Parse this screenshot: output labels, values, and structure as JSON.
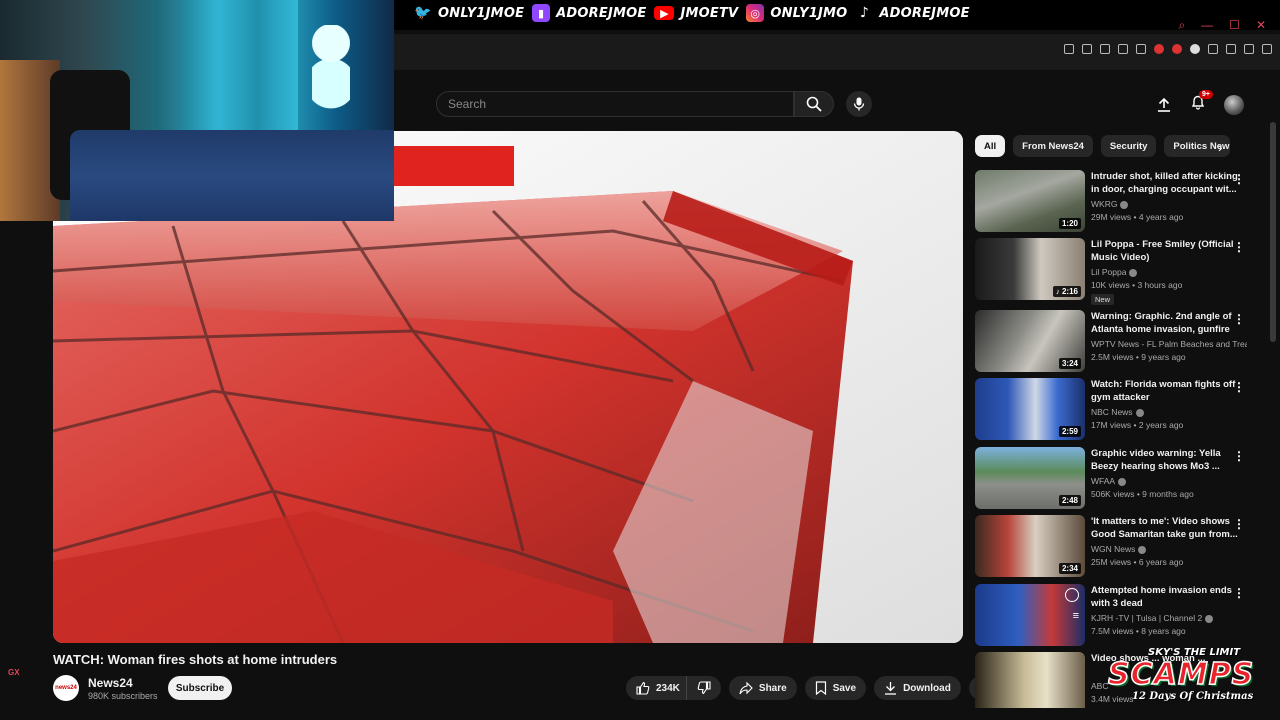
{
  "socials": [
    {
      "platform": "twitter-icon",
      "handle": "ONLY1JMOE",
      "color": "#1da1f2"
    },
    {
      "platform": "twitch-icon",
      "handle": "ADOREJMOE",
      "color": "#9146ff"
    },
    {
      "platform": "youtube-icon",
      "handle": "JMOETV",
      "color": "#ff0000"
    },
    {
      "platform": "instagram-icon",
      "handle": "ONLY1JMO",
      "color": "#e1306c"
    },
    {
      "platform": "tiktok-icon",
      "handle": "ADOREJMOE",
      "color": "#ffffff"
    }
  ],
  "header": {
    "search_placeholder": "Search",
    "notification_count": "9+"
  },
  "video": {
    "title": "WATCH: Woman fires shots at home intruders",
    "channel": "News24",
    "channel_avatar_text": "news24",
    "subscribers": "980K subscribers",
    "subscribe_label": "Subscribe",
    "likes": "234K",
    "share_label": "Share",
    "save_label": "Save",
    "download_label": "Download"
  },
  "chips": [
    "All",
    "From News24",
    "Security",
    "Politics News"
  ],
  "recommendations": [
    {
      "title": "Intruder shot, killed after kicking in door, charging occupant wit...",
      "channel": "WKRG",
      "verified": true,
      "views": "29M views",
      "age": "4 years ago",
      "duration": "1:20",
      "new": false
    },
    {
      "title": "Lil Poppa - Free Smiley (Official Music Video)",
      "channel": "Lil Poppa",
      "verified": true,
      "views": "10K views",
      "age": "3 hours ago",
      "duration": "2:16",
      "new": true,
      "new_label": "New"
    },
    {
      "title": "Warning: Graphic. 2nd angle of Atlanta home invasion, gunfire",
      "channel": "WPTV News - FL Palm Beaches and Trea...",
      "verified": false,
      "views": "2.5M views",
      "age": "9 years ago",
      "duration": "3:24",
      "new": false
    },
    {
      "title": "Watch: Florida woman fights off gym attacker",
      "channel": "NBC News",
      "verified": true,
      "views": "17M views",
      "age": "2 years ago",
      "duration": "2:59",
      "new": false
    },
    {
      "title": "Graphic video warning: Yella Beezy hearing shows Mo3 ...",
      "channel": "WFAA",
      "verified": true,
      "views": "506K views",
      "age": "9 months ago",
      "duration": "2:48",
      "new": false
    },
    {
      "title": "'It matters to me': Video shows Good Samaritan take gun from...",
      "channel": "WGN News",
      "verified": true,
      "views": "25M views",
      "age": "6 years ago",
      "duration": "2:34",
      "new": false
    },
    {
      "title": "Attempted home invasion ends with 3 dead",
      "channel": "KJRH -TV | Tulsa | Channel 2",
      "verified": true,
      "views": "7.5M views",
      "age": "8 years ago",
      "duration": "",
      "new": false
    },
    {
      "title": "Video shows ... woman ...",
      "channel": "ABC",
      "verified": false,
      "views": "3.4M views",
      "age": "",
      "duration": "",
      "new": false
    }
  ],
  "watermark": {
    "top": "SKY'S THE LIMIT",
    "big": "SCAMPS",
    "bottom": "12 Days Of Christmas"
  },
  "corner_label": "GX"
}
